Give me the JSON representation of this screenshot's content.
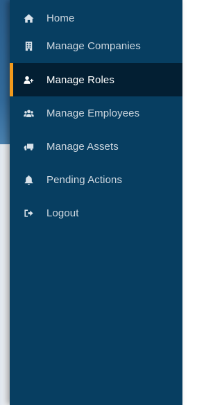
{
  "sidebar": {
    "accent_color": "#f39a1c",
    "background_color": "#073e61",
    "active_background": "#031f33",
    "items": [
      {
        "label": "Home",
        "icon": "home-icon",
        "active": false
      },
      {
        "label": "Manage Companies",
        "icon": "building-icon",
        "active": false
      },
      {
        "label": "Manage Roles",
        "icon": "user-plus-icon",
        "active": true
      },
      {
        "label": "Manage Employees",
        "icon": "users-icon",
        "active": false
      },
      {
        "label": "Manage Assets",
        "icon": "truck-icon",
        "active": false
      },
      {
        "label": "Pending Actions",
        "icon": "bell-icon",
        "active": false
      },
      {
        "label": "Logout",
        "icon": "logout-icon",
        "active": false
      }
    ]
  }
}
